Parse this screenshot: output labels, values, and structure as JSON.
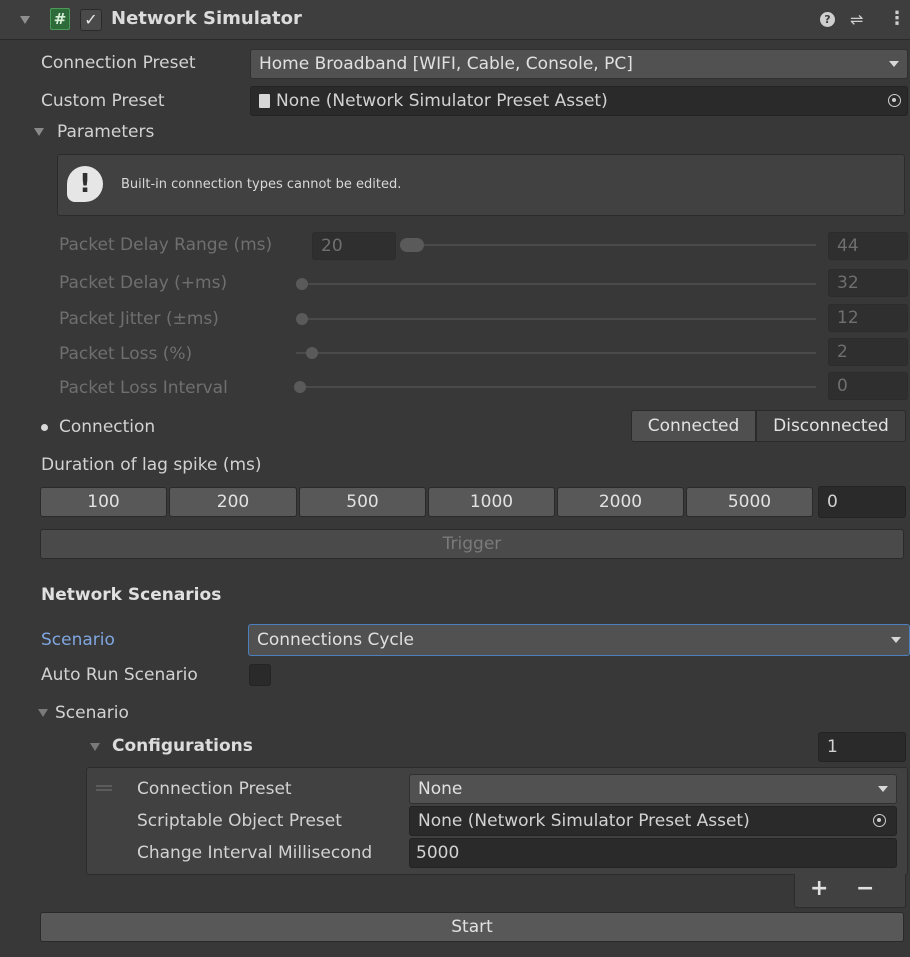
{
  "header": {
    "title": "Network Simulator",
    "enabled": true
  },
  "connection_preset": {
    "label": "Connection Preset",
    "value": "Home Broadband [WIFI, Cable, Console, PC]"
  },
  "custom_preset": {
    "label": "Custom Preset",
    "value": "None (Network Simulator Preset Asset)"
  },
  "parameters": {
    "label": "Parameters",
    "info": "Built-in connection types cannot be edited.",
    "delay_range": {
      "label": "Packet Delay Range (ms)",
      "min": "20",
      "max": "44"
    },
    "delay": {
      "label": "Packet Delay (+ms)",
      "value": "32"
    },
    "jitter": {
      "label": "Packet Jitter (±ms)",
      "value": "12"
    },
    "loss": {
      "label": "Packet Loss (%)",
      "value": "2"
    },
    "loss_interval": {
      "label": "Packet Loss Interval",
      "value": "0"
    }
  },
  "connection": {
    "label": "Connection",
    "connected": "Connected",
    "disconnected": "Disconnected"
  },
  "lag_spike": {
    "label": "Duration of lag spike (ms)",
    "buttons": [
      "100",
      "200",
      "500",
      "1000",
      "2000",
      "5000"
    ],
    "value": "0",
    "trigger": "Trigger"
  },
  "scenarios": {
    "section_title": "Network Scenarios",
    "scenario_label": "Scenario",
    "scenario_value": "Connections Cycle",
    "auto_run_label": "Auto Run Scenario",
    "auto_run": false,
    "foldout": "Scenario",
    "configurations_label": "Configurations",
    "configurations_count": "1",
    "item": {
      "connection_preset_label": "Connection Preset",
      "connection_preset_value": "None",
      "scriptable_label": "Scriptable Object Preset",
      "scriptable_value": "None (Network Simulator Preset Asset)",
      "interval_label": "Change Interval Millisecond",
      "interval_value": "5000"
    },
    "add": "+",
    "remove": "−",
    "start": "Start"
  },
  "colors": {
    "background": "#383838",
    "header": "#3e3e3e",
    "accent_label": "#7fa6e0",
    "focus_border": "#4c7fbf"
  }
}
